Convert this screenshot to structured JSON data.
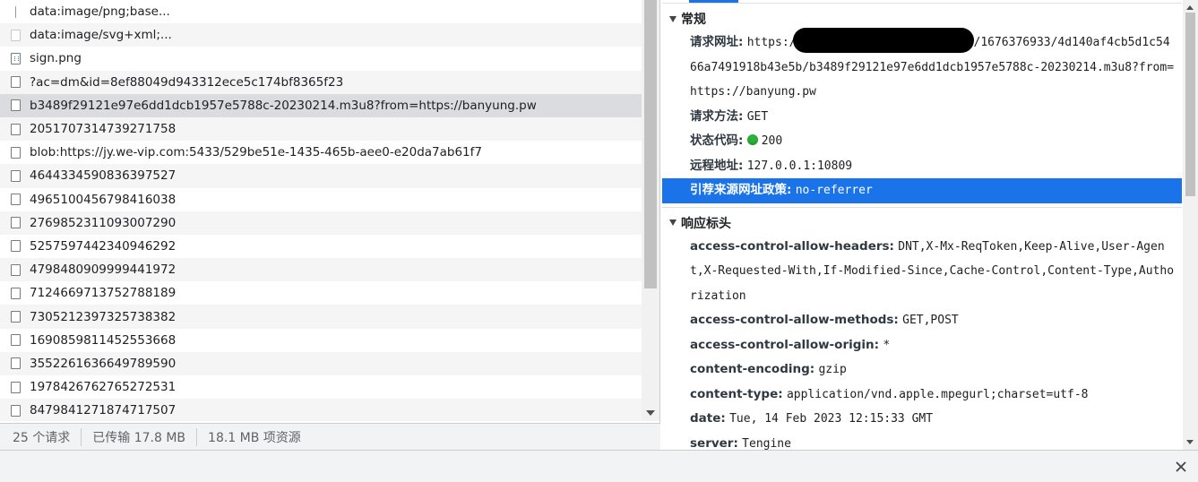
{
  "request_list": [
    {
      "name": "data:image/png;base...",
      "icon": "blank-icon"
    },
    {
      "name": "data:image/svg+xml;...",
      "icon": "faint-file-icon"
    },
    {
      "name": "sign.png",
      "icon": "image-file-icon"
    },
    {
      "name": "?ac=dm&id=8ef88049d943312ece5c174bf8365f23",
      "icon": "file-icon"
    },
    {
      "name": "b3489f29121e97e6dd1dcb1957e5788c-20230214.m3u8?from=https://banyung.pw",
      "icon": "file-icon",
      "selected": true
    },
    {
      "name": "2051707314739271758",
      "icon": "file-icon"
    },
    {
      "name": "blob:https://jy.we-vip.com:5433/529be51e-1435-465b-aee0-e20da7ab61f7",
      "icon": "file-icon"
    },
    {
      "name": "4644334590836397527",
      "icon": "file-icon"
    },
    {
      "name": "4965100456798416038",
      "icon": "file-icon"
    },
    {
      "name": "2769852311093007290",
      "icon": "file-icon"
    },
    {
      "name": "5257597442340946292",
      "icon": "file-icon"
    },
    {
      "name": "4798480909999441972",
      "icon": "file-icon"
    },
    {
      "name": "7124669713752788189",
      "icon": "file-icon"
    },
    {
      "name": "7305212397325738382",
      "icon": "file-icon"
    },
    {
      "name": "1690859811452553668",
      "icon": "file-icon"
    },
    {
      "name": "3552261636649789590",
      "icon": "file-icon"
    },
    {
      "name": "1978426762765272531",
      "icon": "file-icon"
    },
    {
      "name": "8479841271874717507",
      "icon": "file-icon"
    }
  ],
  "status_bar": {
    "requests": "25 个请求",
    "transferred": "已传输 17.8 MB",
    "resources": "18.1 MB 项资源"
  },
  "general": {
    "title": "常规",
    "request_url_key": "请求网址:",
    "request_url_prefix": "https:/",
    "request_url_suffix": "/1676376933/4d140af4cb5d1c5466a7491918b43e5b/b3489f29121e97e6dd1dcb1957e5788c-20230214.m3u8?from=https://banyung.pw",
    "method_key": "请求方法:",
    "method_val": "GET",
    "status_key": "状态代码:",
    "status_val": "200",
    "status_color": "#2bb33a",
    "remote_key": "远程地址:",
    "remote_val": "127.0.0.1:10809",
    "referrer_key": "引荐来源网址政策:",
    "referrer_val": "no-referrer"
  },
  "response_headers": {
    "title": "响应标头",
    "rows": [
      {
        "key": "access-control-allow-headers:",
        "val": "DNT,X-Mx-ReqToken,Keep-Alive,User-Agent,X-Requested-With,If-Modified-Since,Cache-Control,Content-Type,Authorization"
      },
      {
        "key": "access-control-allow-methods:",
        "val": "GET,POST"
      },
      {
        "key": "access-control-allow-origin:",
        "val": "*"
      },
      {
        "key": "content-encoding:",
        "val": "gzip"
      },
      {
        "key": "content-type:",
        "val": "application/vnd.apple.mpegurl;charset=utf-8"
      },
      {
        "key": "date:",
        "val": "Tue, 14 Feb 2023 12:15:33 GMT"
      },
      {
        "key": "server:",
        "val": "Tengine"
      }
    ]
  },
  "colors": {
    "accent": "#1a73e8",
    "selected_row": "#dadce0"
  }
}
